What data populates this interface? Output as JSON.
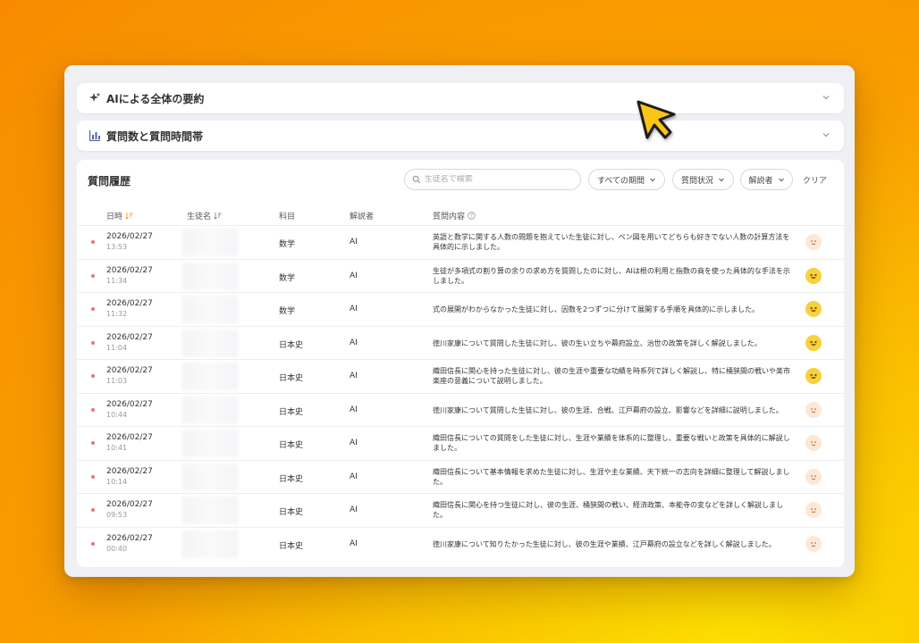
{
  "summary": {
    "title": "AIによる全体の要約",
    "icon": "sparkle-icon"
  },
  "stats": {
    "title": "質問数と質問時間帯",
    "icon": "bar-chart-icon"
  },
  "history": {
    "title": "質問履歴",
    "search_placeholder": "生徒名で検索",
    "filter_period": "すべての期間",
    "filter_status": "質問状況",
    "filter_solver": "解説者",
    "clear_label": "クリア",
    "columns": {
      "date": "日時",
      "student": "生徒名",
      "subject": "科目",
      "solver": "解説者",
      "content": "質問内容"
    },
    "rows": [
      {
        "date": "2026/02/27",
        "time": "13:53",
        "subject": "数学",
        "solver": "AI",
        "content": "英語と数学に関する人数の問題を抱えていた生徒に対し、ベン図を用いてどちらも好きでない人数の計算方法を具体的に示しました。",
        "mood": "neutral",
        "lines": 2
      },
      {
        "date": "2026/02/27",
        "time": "11:34",
        "subject": "数学",
        "solver": "AI",
        "content": "生徒が多項式の割り算の余りの求め方を質問したのに対し、AIは根の利用と指数の商を使った具体的な手法を示しました。",
        "mood": "happy",
        "lines": 2
      },
      {
        "date": "2026/02/27",
        "time": "11:32",
        "subject": "数学",
        "solver": "AI",
        "content": "式の展開がわからなかった生徒に対し、因数を2つずつに分けて展開する手順を具体的に示しました。",
        "mood": "happy",
        "lines": 1
      },
      {
        "date": "2026/02/27",
        "time": "11:04",
        "subject": "日本史",
        "solver": "AI",
        "content": "徳川家康について質問した生徒に対し、彼の生い立ちや幕府設立、治世の政策を詳しく解説しました。",
        "mood": "happy",
        "lines": 1
      },
      {
        "date": "2026/02/27",
        "time": "11:03",
        "subject": "日本史",
        "solver": "AI",
        "content": "織田信長に関心を持った生徒に対し、彼の生涯や重要な功績を時系列で詳しく解説し、特に桶狭間の戦いや楽市楽座の意義について説明しました。",
        "mood": "happy",
        "lines": 2
      },
      {
        "date": "2026/02/27",
        "time": "10:44",
        "subject": "日本史",
        "solver": "AI",
        "content": "徳川家康について質問した生徒に対し、彼の生涯、合戦、江戸幕府の設立、影響などを詳細に説明しました。",
        "mood": "neutral",
        "lines": 1
      },
      {
        "date": "2026/02/27",
        "time": "10:41",
        "subject": "日本史",
        "solver": "AI",
        "content": "織田信長についての質問をした生徒に対し、生涯や業績を体系的に整理し、重要な戦いと政策を具体的に解説しました。",
        "mood": "neutral",
        "lines": 2
      },
      {
        "date": "2026/02/27",
        "time": "10:14",
        "subject": "日本史",
        "solver": "AI",
        "content": "織田信長について基本情報を求めた生徒に対し、生涯や主な業績、天下統一の志向を詳細に整理して解説しました。",
        "mood": "neutral",
        "lines": 2
      },
      {
        "date": "2026/02/27",
        "time": "09:53",
        "subject": "日本史",
        "solver": "AI",
        "content": "織田信長に関心を持つ生徒に対し、彼の生涯、桶狭間の戦い、経済政策、本能寺の変などを詳しく解説しました。",
        "mood": "neutral",
        "lines": 2
      },
      {
        "date": "2026/02/27",
        "time": "00:40",
        "subject": "日本史",
        "solver": "AI",
        "content": "徳川家康について知りたかった生徒に対し、彼の生涯や業績、江戸幕府の設立などを詳しく解説しました。",
        "mood": "neutral",
        "lines": 1
      }
    ]
  },
  "colors": {
    "background_top": "#f88a00",
    "background_bottom": "#fde000",
    "cursor_fill": "#fcc419",
    "happy_face": "#f7d23d",
    "neutral_face": "#fde8d6"
  }
}
